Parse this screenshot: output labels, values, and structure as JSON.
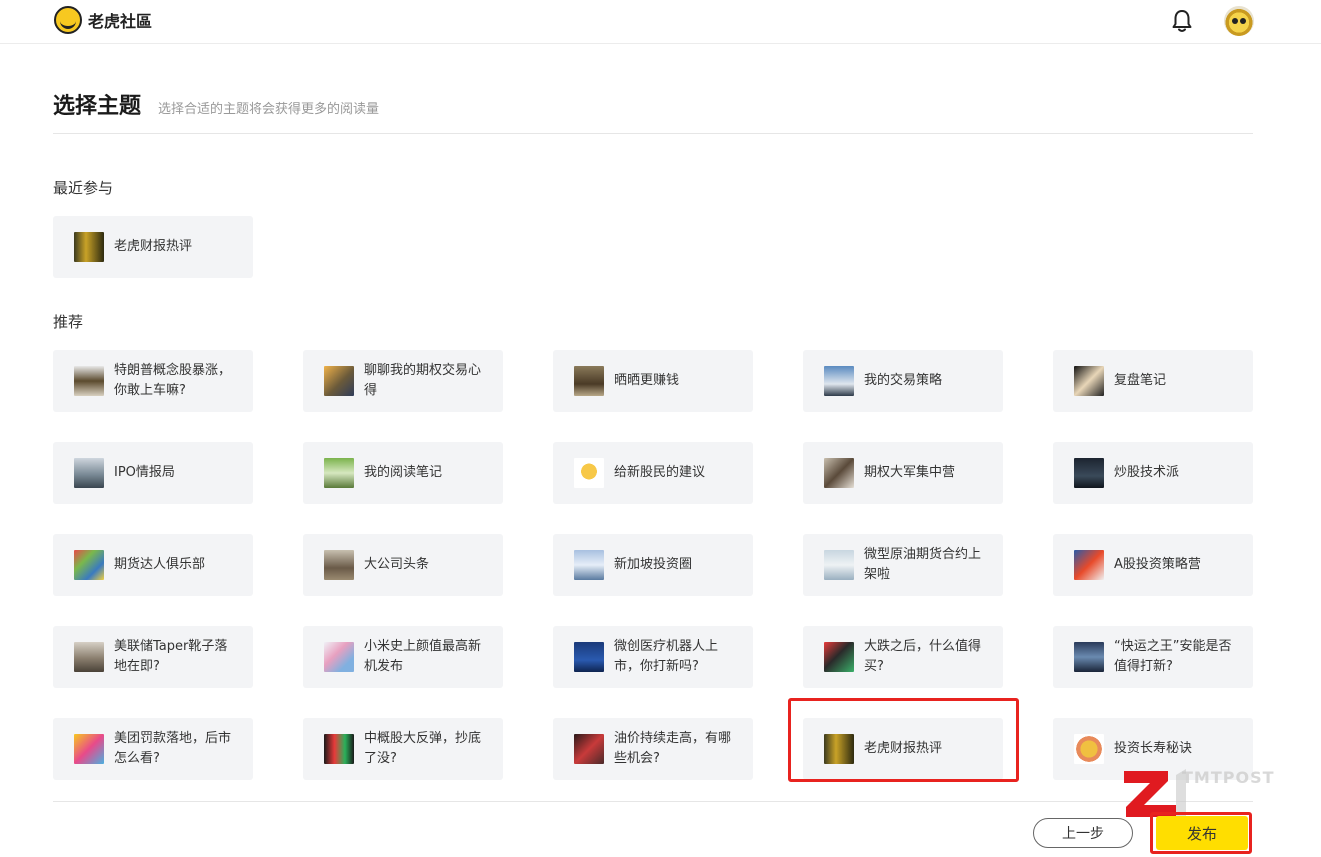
{
  "header": {
    "logo_text": "老虎社區",
    "bell_icon": "bell-icon",
    "avatar_icon": "tiger-avatar"
  },
  "page": {
    "title": "选择主题",
    "subtitle": "选择合适的主题将会获得更多的阅读量"
  },
  "recent": {
    "label": "最近参与",
    "items": [
      {
        "label": "老虎财报热评",
        "thumb": "linear-gradient(90deg,#3b3a1e,#c9a227 40%,#2d2a10)"
      }
    ]
  },
  "recommend": {
    "label": "推荐",
    "items": [
      {
        "label": "特朗普概念股暴涨，你敢上车嘛?",
        "thumb": "linear-gradient(180deg,#e8e8e8,#5b4a2e 50%,#d8d0c0)"
      },
      {
        "label": "聊聊我的期权交易心得",
        "thumb": "linear-gradient(135deg,#f0b24a,#6b5a3a 55%,#2f3c5a)"
      },
      {
        "label": "晒晒更赚钱",
        "thumb": "linear-gradient(180deg,#8a7a5a,#4a3a26 60%,#b8a888)"
      },
      {
        "label": "我的交易策略",
        "thumb": "linear-gradient(180deg,#5a8ac0,#dfe6ee 60%,#2e3b4a)"
      },
      {
        "label": "复盘笔记",
        "thumb": "linear-gradient(135deg,#111,#e8d6b8 50%,#222)"
      },
      {
        "label": "IPO情报局",
        "thumb": "linear-gradient(180deg,#cfd6de,#7a8a96 55%,#3a4650)"
      },
      {
        "label": "我的阅读笔记",
        "thumb": "linear-gradient(180deg,#7bb34c,#d6e8c0 50%,#5a7a3a)"
      },
      {
        "label": "给新股民的建议",
        "thumb": "radial-gradient(circle at 50% 45%,#f7c848 0 35%,#ffffff 36%)"
      },
      {
        "label": "期权大军集中营",
        "thumb": "linear-gradient(135deg,#c9c0b0,#5a4a3a 50%,#e6e0d6)"
      },
      {
        "label": "炒股技术派",
        "thumb": "linear-gradient(180deg,#1c2430,#3a4a5a 60%,#10161e)"
      },
      {
        "label": "期货达人俱乐部",
        "thumb": "linear-gradient(135deg,#e84a4a,#7ab84c 35%,#3a7ac0 70%,#f0d040)"
      },
      {
        "label": "大公司头条",
        "thumb": "linear-gradient(180deg,#c8c0b0,#6a5a48 60%,#9a8a70)"
      },
      {
        "label": "新加坡投资圈",
        "thumb": "linear-gradient(180deg,#a8c0e0,#e6eef8 50%,#5a7aa0)"
      },
      {
        "label": "微型原油期货合约上架啦",
        "thumb": "linear-gradient(180deg,#c8d6e0,#eef2f4 50%,#9ab0c0)"
      },
      {
        "label": "A股投资策略营",
        "thumb": "linear-gradient(135deg,#2a5aa8,#e84a2a 50%,#f0f0f0)"
      },
      {
        "label": "美联储Taper靴子落地在即?",
        "thumb": "linear-gradient(180deg,#d6d0c6,#8a7e6e 55%,#4a4238)"
      },
      {
        "label": "小米史上颜值最高新机发布",
        "thumb": "linear-gradient(135deg,#f0f0f6,#e8a0c0 40%,#80b0e0 75%)"
      },
      {
        "label": "微创医疗机器人上市，你打新吗?",
        "thumb": "linear-gradient(180deg,#1a3a7a,#2a5ab0 60%,#0e2450)"
      },
      {
        "label": "大跌之后，什么值得买?",
        "thumb": "linear-gradient(135deg,#e83a3a,#2a2a2a 45%,#3ab06a)"
      },
      {
        "label": "“快运之王”安能是否值得打新?",
        "thumb": "linear-gradient(180deg,#2a3a5a,#6a8ab0 50%,#1a2438)"
      },
      {
        "label": "美团罚款落地，后市怎么看?",
        "thumb": "linear-gradient(135deg,#f7c820,#e84a8a 50%,#4ab0e0)"
      },
      {
        "label": "中概股大反弹，抄底了没?",
        "thumb": "linear-gradient(90deg,#1a1a1a,#e83a3a 35%,#2ab05a 70%,#1a1a1a)"
      },
      {
        "label": "油价持续走高，有哪些机会?",
        "thumb": "linear-gradient(135deg,#2a1a1a,#c83a3a 50%,#4a2a2a)"
      },
      {
        "label": "老虎财报热评",
        "thumb": "linear-gradient(90deg,#3b3a1e,#c9a227 40%,#2d2a10)"
      },
      {
        "label": "投资长寿秘诀",
        "thumb": "radial-gradient(circle at 50% 50%,#f0c040 0 40%,#e88a5a 41% 60%,#fff 61%)"
      }
    ]
  },
  "footer": {
    "prev_label": "上一步",
    "publish_label": "发布"
  },
  "watermark": {
    "text": "TMTPOST"
  },
  "colors": {
    "publish_button": "#ffde00",
    "highlight_border": "#e8231f",
    "card_bg": "#f3f4f6"
  }
}
